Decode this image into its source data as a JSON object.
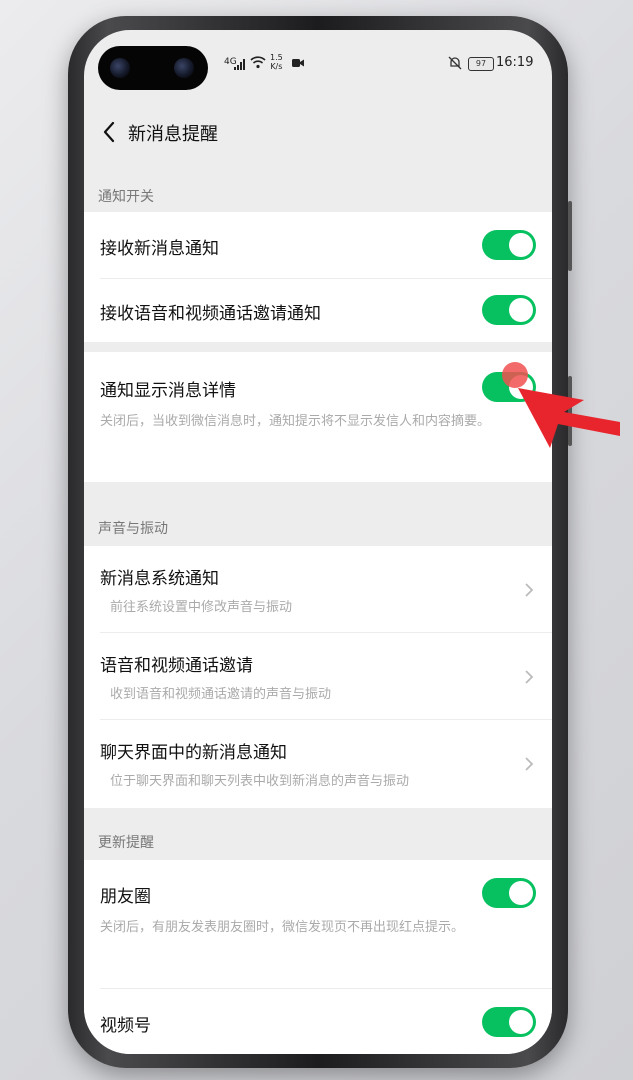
{
  "status_bar": {
    "signal_label": "4G",
    "speed_value": "1.5",
    "speed_unit": "K/s",
    "battery": "97",
    "time": "16:19"
  },
  "nav": {
    "title": "新消息提醒"
  },
  "sections": {
    "notify": {
      "label": "通知开关"
    },
    "sound": {
      "label": "声音与振动"
    },
    "update": {
      "label": "更新提醒"
    }
  },
  "rows": {
    "receive_new": {
      "title": "接收新消息通知",
      "on": true
    },
    "receive_call": {
      "title": "接收语音和视频通话邀请通知",
      "on": true
    },
    "show_detail": {
      "title": "通知显示消息详情",
      "sub": "关闭后，当收到微信消息时，通知提示将不显示发信人和内容摘要。",
      "on": true
    },
    "sys_notify": {
      "title": "新消息系统通知",
      "sub": "前往系统设置中修改声音与振动"
    },
    "call_invite": {
      "title": "语音和视频通话邀请",
      "sub": "收到语音和视频通话邀请的声音与振动"
    },
    "chat_notify": {
      "title": "聊天界面中的新消息通知",
      "sub": "位于聊天界面和聊天列表中收到新消息的声音与振动"
    },
    "moments": {
      "title": "朋友圈",
      "sub": "关闭后，有朋友发表朋友圈时，微信发现页不再出现红点提示。",
      "on": true
    },
    "channels": {
      "title": "视频号",
      "on": true
    }
  },
  "colors": {
    "accent": "#07c160",
    "pointer": "#e8242c"
  }
}
